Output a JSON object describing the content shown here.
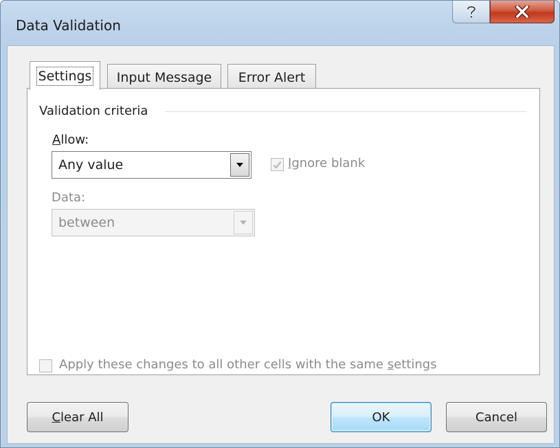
{
  "dialog": {
    "title": "Data Validation",
    "help_glyph": "?",
    "close_glyph": "X"
  },
  "tabs": [
    {
      "label": "Settings",
      "active": true
    },
    {
      "label": "Input Message",
      "active": false
    },
    {
      "label": "Error Alert",
      "active": false
    }
  ],
  "settings": {
    "group_label": "Validation criteria",
    "allow": {
      "label_mnemonic": "A",
      "label_rest": "llow:",
      "value": "Any value"
    },
    "ignore_blank": {
      "label_pre": "",
      "label_mnemonic": "I",
      "label_rest": "gnore blank",
      "checked": true,
      "enabled": false
    },
    "data": {
      "label_mnemonic": "D",
      "label_rest": "ata:",
      "value": "between",
      "enabled": false
    },
    "apply_all": {
      "label_pre": "Apply these changes to all other cells with the same ",
      "label_mnemonic": "s",
      "label_rest": "ettings",
      "checked": false,
      "enabled": false
    }
  },
  "buttons": {
    "clear_all": {
      "mnemonic": "C",
      "rest": "lear All"
    },
    "ok": "OK",
    "cancel": "Cancel"
  }
}
